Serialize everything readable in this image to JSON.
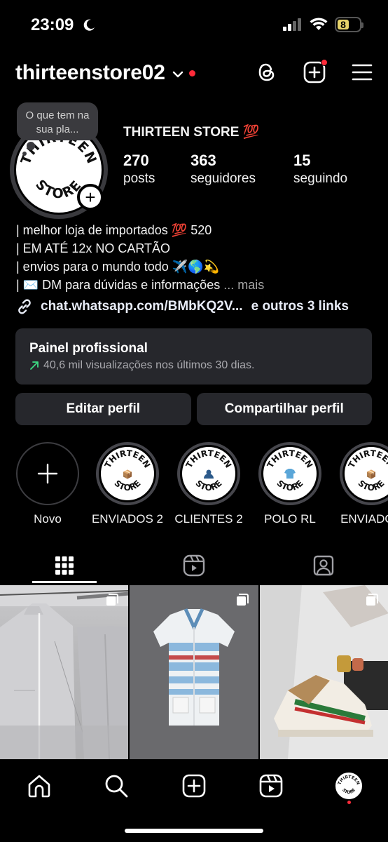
{
  "status_bar": {
    "time": "23:09",
    "battery_level": "8"
  },
  "header": {
    "username": "thirteenstore02"
  },
  "profile": {
    "note": "O que tem na sua pla...",
    "display_name": "THIRTEEN STORE 💯",
    "avatar_text_top": "THIRTEEN",
    "avatar_text_bottom": "STORE",
    "stats": [
      {
        "value": "270",
        "label": "posts"
      },
      {
        "value": "363",
        "label": "seguidores"
      },
      {
        "value": "15",
        "label": "seguindo"
      }
    ],
    "bio_lines": [
      "| melhor loja de importados 💯 520",
      "| EM ATÉ 12x NO CARTÃO",
      "| envios para o mundo todo ✈️🌎💫",
      "| ✉️ DM para dúvidas e informações"
    ],
    "bio_more": "... mais",
    "link_text": "chat.whatsapp.com/BMbKQ2V...",
    "link_others": "e outros 3 links"
  },
  "pro_panel": {
    "title": "Painel profissional",
    "subtitle": "40,6 mil visualizações nos últimos 30 dias."
  },
  "actions": {
    "edit_label": "Editar perfil",
    "share_label": "Compartilhar perfil"
  },
  "highlights": [
    {
      "label": "Novo"
    },
    {
      "label": "ENVIADOS 2"
    },
    {
      "label": "CLIENTES 2"
    },
    {
      "label": "POLO RL"
    },
    {
      "label": "ENVIADOS"
    }
  ],
  "colors": {
    "background": "#000000",
    "panel": "#26272c",
    "notification": "#ff2b3a",
    "trend_arrow": "#3ddc84"
  }
}
